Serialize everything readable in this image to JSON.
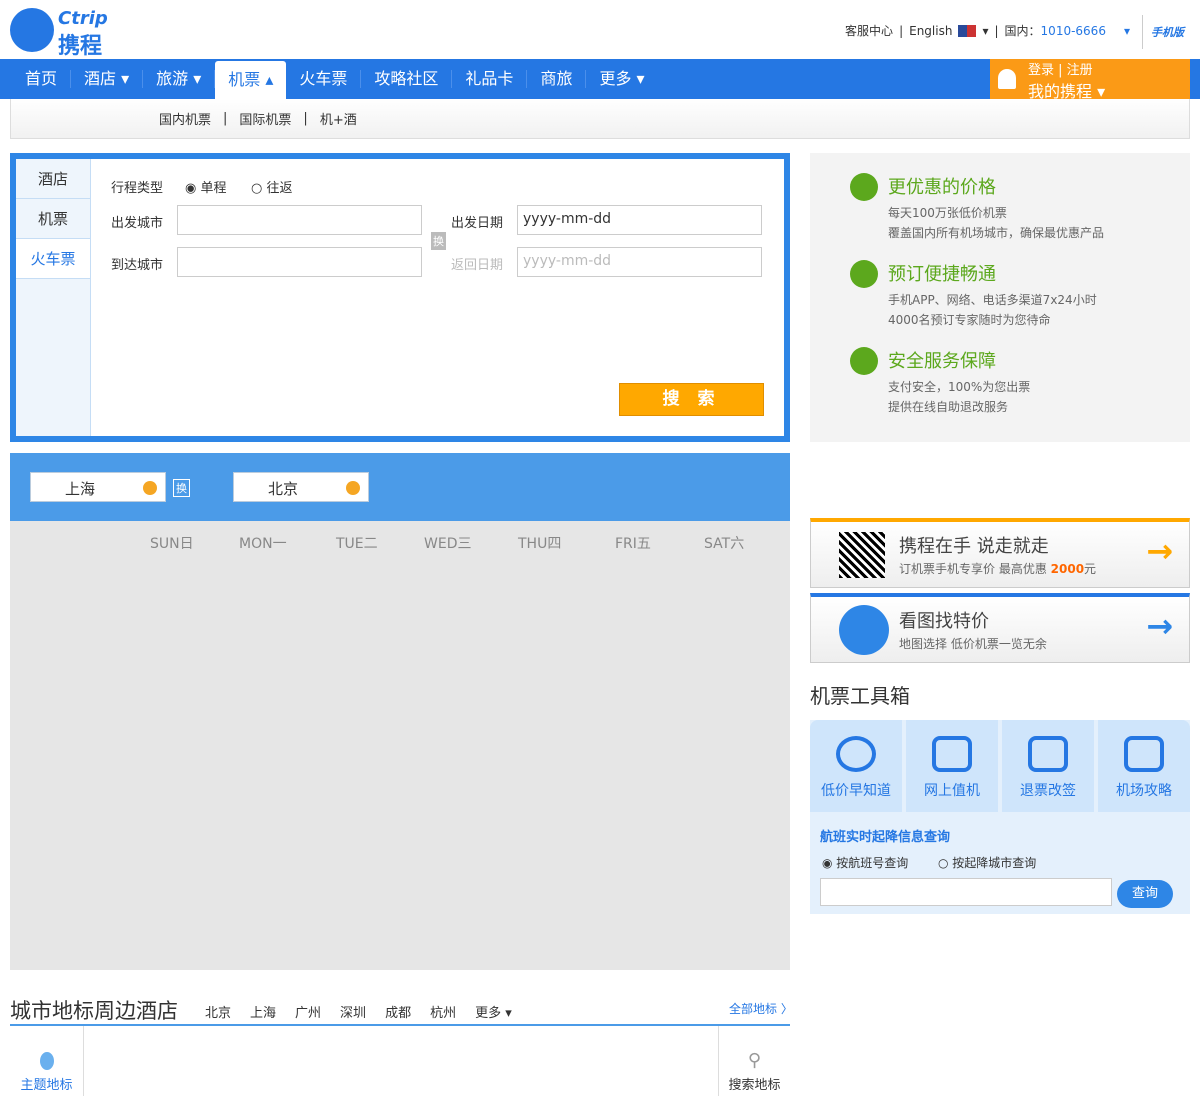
{
  "logo": {
    "en": "Ctrip",
    "cn": "携程"
  },
  "top": {
    "service": "客服中心",
    "lang": "English",
    "domestic": "国内：",
    "phone": "1010-6666",
    "mobile": "手机版"
  },
  "nav": [
    "首页",
    "酒店 ▾",
    "旅游 ▾",
    "机票 ▴",
    "火车票",
    "攻略社区",
    "礼品卡",
    "商旅",
    "更多 ▾"
  ],
  "login": {
    "line1": "登录 | 注册",
    "line2": "我的携程 ▾"
  },
  "subnav": [
    "国内机票",
    "|",
    "国际机票",
    "|",
    "机+酒"
  ],
  "search": {
    "tabs": [
      "酒店",
      "机票",
      "火车票"
    ],
    "trip_type": "行程类型",
    "one_way": "单程",
    "round": "往返",
    "from_city": "出发城市",
    "to_city": "到达城市",
    "swap": "换",
    "depart_date": "出发日期",
    "return_date": "返回日期",
    "date_placeholder": "yyyy-mm-dd",
    "search_btn": "搜 索"
  },
  "features": [
    {
      "title": "更优惠的价格",
      "l1": "每天100万张低价机票",
      "l2": "覆盖国内所有机场城市，确保最优惠产品"
    },
    {
      "title": "预订便捷畅通",
      "l1": "手机APP、网络、电话多渠道7x24小时",
      "l2": "4000名预订专家随时为您待命"
    },
    {
      "title": "安全服务保障",
      "l1": "支付安全，100%为您出票",
      "l2": "提供在线自助退改服务"
    }
  ],
  "calendar": {
    "from": "上海",
    "to": "北京",
    "swap": "换",
    "weekdays": [
      "SUN日",
      "MON一",
      "TUE二",
      "WED三",
      "THU四",
      "FRI五",
      "SAT六"
    ]
  },
  "promos": [
    {
      "title": "携程在手 说走就走",
      "sub": "订机票手机专享价  最高优惠 ",
      "amount": "2000",
      "unit": "元"
    },
    {
      "title": "看图找特价",
      "sub": "地图选择  低价机票一览无余"
    }
  ],
  "toolbox": {
    "title": "机票工具箱",
    "items": [
      "低价早知道",
      "网上值机",
      "退票改签",
      "机场攻略"
    ],
    "flight_title": "航班实时起降信息查询",
    "opt1": "按航班号查询",
    "opt2": "按起降城市查询",
    "query": "查询"
  },
  "landmarks": {
    "title": "城市地标周边酒店",
    "cities": [
      "北京",
      "上海",
      "广州",
      "深圳",
      "成都",
      "杭州",
      "更多 ▾"
    ],
    "all": "全部地标 〉",
    "theme": "主题地标",
    "searchmark": "搜索地标"
  }
}
